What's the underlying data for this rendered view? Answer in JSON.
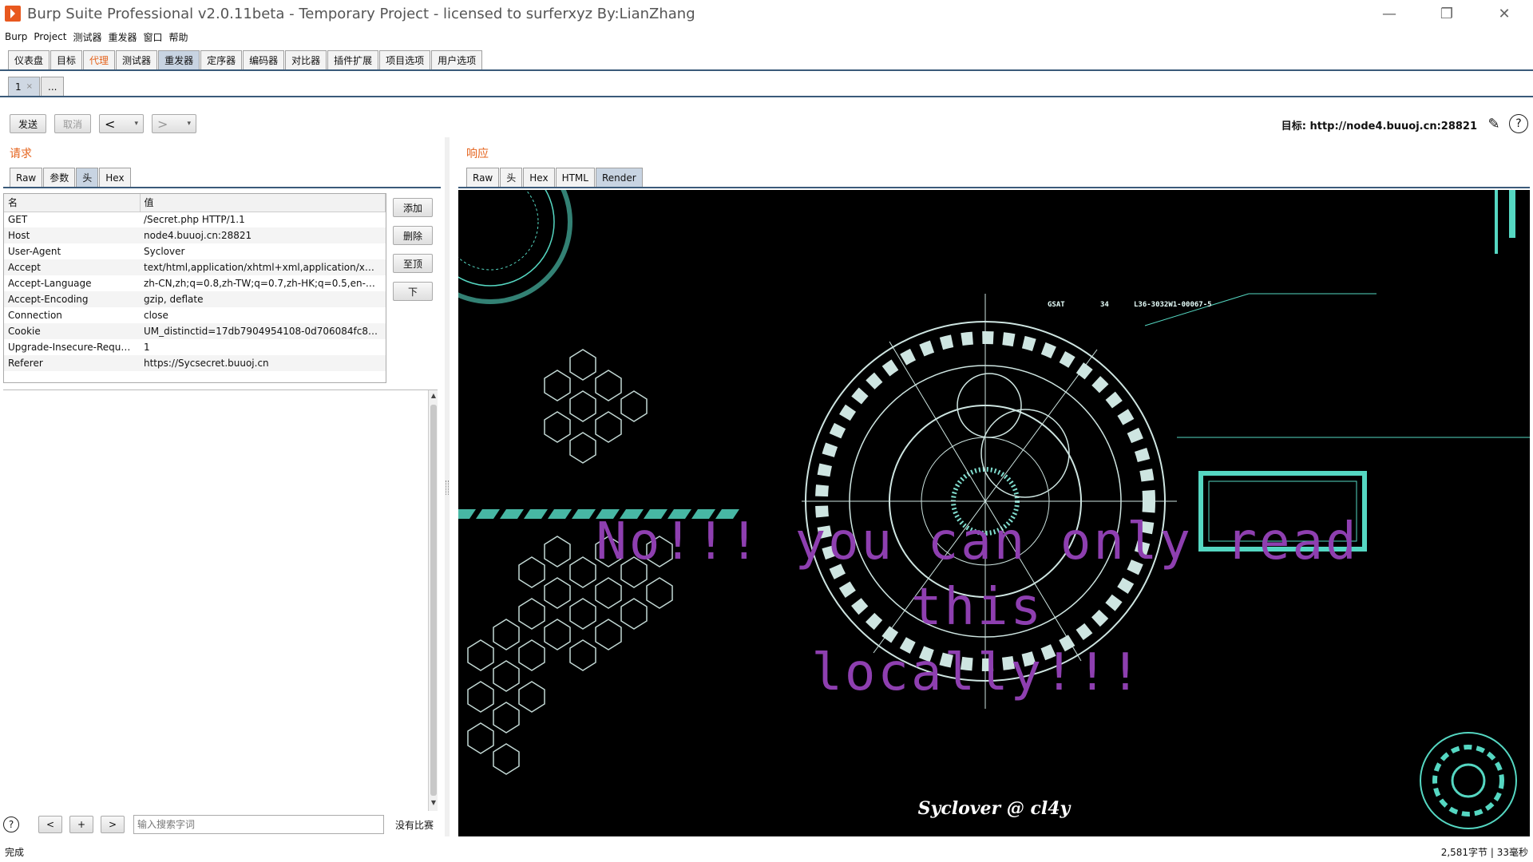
{
  "window": {
    "title": "Burp Suite Professional v2.0.11beta - Temporary Project - licensed to surferxyz By:LianZhang",
    "minimize": "—",
    "restore": "❐",
    "close": "✕"
  },
  "menu": [
    "Burp",
    "Project",
    "测试器",
    "重发器",
    "窗口",
    "帮助"
  ],
  "top_tabs": [
    {
      "label": "仪表盘"
    },
    {
      "label": "目标"
    },
    {
      "label": "代理",
      "color": "#e5641e"
    },
    {
      "label": "测试器"
    },
    {
      "label": "重发器",
      "active": true
    },
    {
      "label": "定序器"
    },
    {
      "label": "编码器"
    },
    {
      "label": "对比器"
    },
    {
      "label": "插件扩展"
    },
    {
      "label": "项目选项"
    },
    {
      "label": "用户选项"
    }
  ],
  "repeater_tabs": [
    {
      "label": "1",
      "close": "×",
      "active": true
    },
    {
      "label": "..."
    }
  ],
  "toolbar": {
    "send": "发送",
    "cancel": "取消",
    "back": "<",
    "forward": ">",
    "dropdown": "▾",
    "target": "目标: http://node4.buuoj.cn:28821",
    "pencil_icon": "✎",
    "help_icon": "?"
  },
  "request": {
    "label": "请求",
    "tabs": [
      {
        "label": "Raw"
      },
      {
        "label": "参数"
      },
      {
        "label": "头",
        "active": true
      },
      {
        "label": "Hex"
      }
    ],
    "table": {
      "columns": [
        "名",
        "值"
      ],
      "rows": [
        {
          "name": "GET",
          "value": "/Secret.php HTTP/1.1"
        },
        {
          "name": "Host",
          "value": "node4.buuoj.cn:28821"
        },
        {
          "name": "User-Agent",
          "value": "Syclover"
        },
        {
          "name": "Accept",
          "value": "text/html,application/xhtml+xml,application/xml;q..."
        },
        {
          "name": "Accept-Language",
          "value": "zh-CN,zh;q=0.8,zh-TW;q=0.7,zh-HK;q=0.5,en-U..."
        },
        {
          "name": "Accept-Encoding",
          "value": "gzip, deflate"
        },
        {
          "name": "Connection",
          "value": "close"
        },
        {
          "name": "Cookie",
          "value": "UM_distinctid=17db7904954108-0d706084fc842f8..."
        },
        {
          "name": "Upgrade-Insecure-Reque...",
          "value": "1"
        },
        {
          "name": "Referer",
          "value": "https://Sycsecret.buuoj.cn"
        }
      ]
    },
    "side_buttons": [
      "添加",
      "删除",
      "至顶",
      "下"
    ],
    "search": {
      "help": "?",
      "prev": "<",
      "add": "+",
      "next": ">",
      "placeholder": "输入搜索字词",
      "result": "没有比赛"
    }
  },
  "response": {
    "label": "响应",
    "tabs": [
      {
        "label": "Raw"
      },
      {
        "label": "头"
      },
      {
        "label": "Hex"
      },
      {
        "label": "HTML"
      },
      {
        "label": "Render",
        "active": true
      }
    ],
    "render": {
      "message_line1": "No!!! you can only read this",
      "message_line2": "locally!!!",
      "footer": "Syclover @ cl4y",
      "hud_text_1": "GSAT",
      "hud_text_2": "34",
      "hud_text_3": "L36-3032W1-00067-5",
      "accent_color": "#5ff0d8",
      "message_color": "#8e3fb0"
    }
  },
  "status": {
    "left": "完成",
    "right": "2,581字节 | 33毫秒"
  }
}
